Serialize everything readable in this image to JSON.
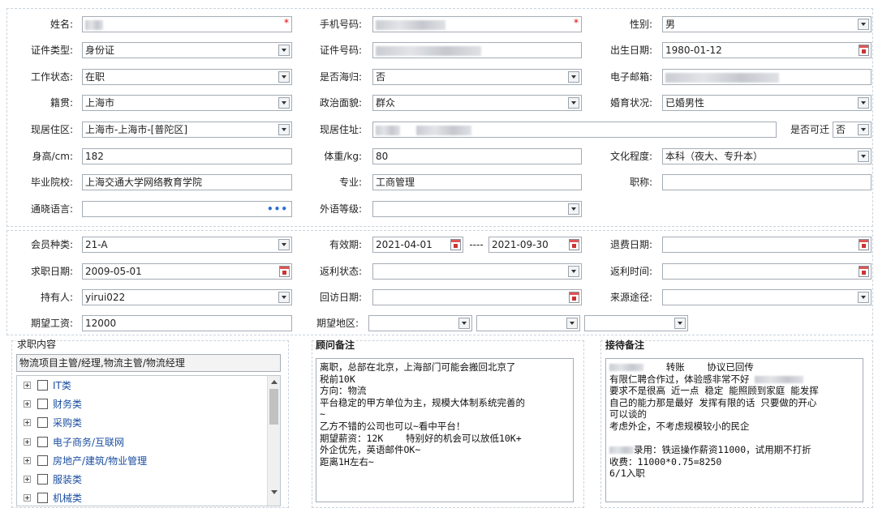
{
  "labels": {
    "name": "姓名:",
    "mobile": "手机号码:",
    "gender": "性别:",
    "id_type": "证件类型:",
    "id_number": "证件号码:",
    "birth_date": "出生日期:",
    "work_status": "工作状态:",
    "returnee": "是否海归:",
    "email": "电子邮箱:",
    "native_place": "籍贯:",
    "political": "政治面貌:",
    "marital": "婚育状况:",
    "residence": "现居住区:",
    "address": "现居住址:",
    "relocate": "是否可迁",
    "height": "身高/cm:",
    "weight": "体重/kg:",
    "education": "文化程度:",
    "school": "毕业院校:",
    "major": "专业:",
    "title": "职称:",
    "languages": "通晓语言:",
    "foreign_level": "外语等级:",
    "member_type": "会员种类:",
    "validity": "有效期:",
    "refund_date": "退费日期:",
    "job_date": "求职日期:",
    "rebate_status": "返利状态:",
    "rebate_time": "返利时间:",
    "holder": "持有人:",
    "visit_date": "回访日期:",
    "source": "来源途径:",
    "expected_salary": "期望工资:",
    "expected_area": "期望地区:"
  },
  "values": {
    "gender": "男",
    "id_type": "身份证",
    "birth_date": "1980-01-12",
    "work_status": "在职",
    "returnee": "否",
    "native_place": "上海市",
    "political": "群众",
    "marital": "已婚男性",
    "residence": "上海市-上海市-[普陀区]",
    "relocate": "否",
    "height": "182",
    "weight": "80",
    "education": "本科（夜大、专升本）",
    "school": "上海交通大学网络教育学院",
    "major": "工商管理",
    "member_type": "21-A",
    "validity_start": "2021-04-01",
    "validity_sep": "----",
    "validity_end": "2021-09-30",
    "job_date": "2009-05-01",
    "holder": "yirui022",
    "expected_salary": "12000",
    "required_mark": "*"
  },
  "job_panel": {
    "title": "求职内容",
    "selected": "物流项目主管/经理,物流主管/物流经理",
    "tree": [
      "IT类",
      "财务类",
      "采购类",
      "电子商务/互联网",
      "房地产/建筑/物业管理",
      "服装类",
      "机械类"
    ]
  },
  "advisor_panel": {
    "title": "顾问备注",
    "text": "离职，总部在北京，上海部门可能会搬回北京了\n税前10K\n方向：物流\n平台稳定的甲方单位为主，规模大体制系统完善的\n~\n乙方不错的公司也可以~看中平台！\n期望薪资：12K    特别好的机会可以放低10K+\n外企优先，英语邮件OK~\n距离1H左右~"
  },
  "reception_panel": {
    "title": "接待备注",
    "line1_a": "转账",
    "line1_b": "协议已回传",
    "line2_a": "有限仁聘合作过，体验感非常不好",
    "rest_a": "要求不是很高 近一点 稳定 能照顾到家庭 能发挥\n自己的能力那是最好 发挥有限的话 只要做的开心\n可以谈的\n考虑外企，不考虑规模较小的民企\n",
    "line_hire": "录用：铁运操作薪资11000，试用期不打折",
    "rest_b": "收费：11000*0.75=8250\n6/1入职"
  },
  "icons": {
    "dropdown": "chevron-down-icon",
    "calendar": "calendar-icon",
    "more": "ellipsis-icon",
    "expand": "plus-box-icon",
    "checkbox": "checkbox-icon"
  },
  "colors": {
    "required": "#dd0000",
    "calendar_accent": "#cc3333",
    "tree_text": "#1a4ea0",
    "border": "#a5acb5"
  }
}
